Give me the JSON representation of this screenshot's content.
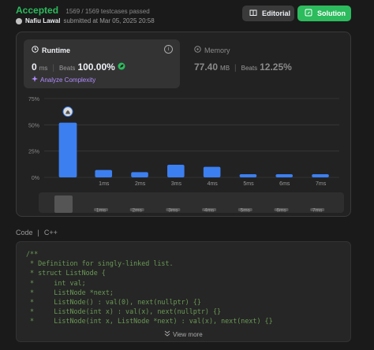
{
  "header": {
    "status": "Accepted",
    "testcases": "1569 / 1569 testcases passed",
    "author": "Nafiu Lawal",
    "submitted": "submitted at Mar 05, 2025 20:58",
    "editorial_label": "Editorial",
    "solution_label": "Solution"
  },
  "runtime": {
    "title": "Runtime",
    "value": "0",
    "unit": "ms",
    "beats_label": "Beats",
    "beats_value": "100.00%",
    "analyze_label": "Analyze Complexity"
  },
  "memory": {
    "title": "Memory",
    "value": "77.40",
    "unit": "MB",
    "beats_label": "Beats",
    "beats_value": "12.25%"
  },
  "chart_data": {
    "type": "bar",
    "categories": [
      "",
      "1ms",
      "2ms",
      "3ms",
      "4ms",
      "5ms",
      "6ms",
      "7ms"
    ],
    "values": [
      52,
      7,
      5,
      12,
      10,
      3,
      3,
      3
    ],
    "ylim": [
      0,
      75
    ],
    "yticks": [
      "75%",
      "50%",
      "25%",
      "0%"
    ],
    "highlight_index": 0,
    "bar_color": "#3c7ff0",
    "scrubber_labels": [
      "1ms",
      "2ms",
      "3ms",
      "4ms",
      "5ms",
      "6ms",
      "7ms"
    ]
  },
  "code": {
    "language_tab": "Code",
    "language": "C++",
    "lines": [
      "/**",
      " * Definition for singly-linked list.",
      " * struct ListNode {",
      " *     int val;",
      " *     ListNode *next;",
      " *     ListNode() : val(0), next(nullptr) {}",
      " *     ListNode(int x) : val(x), next(nullptr) {}",
      " *     ListNode(int x, ListNode *next) : val(x), next(next) {}"
    ],
    "view_more": "View more"
  },
  "colors": {
    "accent_green": "#2cbb5d",
    "analyze_purple": "#b18cff"
  }
}
